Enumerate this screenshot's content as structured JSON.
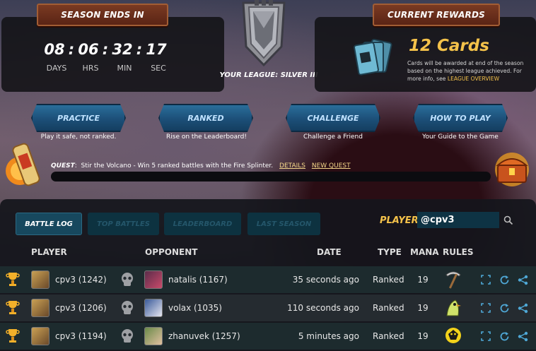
{
  "season": {
    "banner": "SEASON ENDS IN",
    "timer": [
      {
        "value": "08",
        "label": "DAYS"
      },
      {
        "value": "06",
        "label": "HRS"
      },
      {
        "value": "32",
        "label": "MIN"
      },
      {
        "value": "17",
        "label": "SEC"
      }
    ],
    "separator": ":"
  },
  "league": {
    "text": "YOUR LEAGUE: SILVER III",
    "shield_icon": "league-shield-icon"
  },
  "rewards": {
    "banner": "CURRENT REWARDS",
    "cards": "12 Cards",
    "description": "Cards will be awarded at end of the season based on the highest league achieved. For more info, see",
    "link": "LEAGUE OVERVIEW"
  },
  "modes": [
    {
      "label": "PRACTICE",
      "sub": "Play it safe, not ranked."
    },
    {
      "label": "RANKED",
      "sub": "Rise on the Leaderboard!"
    },
    {
      "label": "CHALLENGE",
      "sub": "Challenge a Friend"
    },
    {
      "label": "HOW TO PLAY",
      "sub": "Your Guide to the Game"
    }
  ],
  "quest": {
    "label": "QUEST",
    "text": "Stir the Volcano - Win 5 ranked battles with the Fire Splinter.",
    "details": "DETAILS",
    "new_quest": "NEW QUEST",
    "progress": 0
  },
  "tabs": [
    "BATTLE LOG",
    "TOP BATTLES",
    "LEADERBOARD",
    "LAST SEASON"
  ],
  "player_search": {
    "label": "PLAYER:",
    "value": "@cpv3"
  },
  "columns": [
    "PLAYER",
    "OPPONENT",
    "DATE",
    "TYPE",
    "MANA",
    "RULES"
  ],
  "battles": [
    {
      "player": "cpv3 (1242)",
      "opponent": "natalis (1167)",
      "date": "35 seconds ago",
      "type": "Ranked",
      "mana": "19",
      "rule_icon": "pickaxe-rule-icon"
    },
    {
      "player": "cpv3 (1206)",
      "opponent": "volax (1035)",
      "date": "110 seconds ago",
      "type": "Ranked",
      "mana": "19",
      "rule_icon": "bird-rule-icon"
    },
    {
      "player": "cpv3 (1194)",
      "opponent": "zhanuvek (1257)",
      "date": "5 minutes ago",
      "type": "Ranked",
      "mana": "19",
      "rule_icon": "creature-rule-icon"
    }
  ],
  "colors": {
    "gold": "#f4c24a",
    "panel": "#121216",
    "tab_active": "#17485e"
  }
}
